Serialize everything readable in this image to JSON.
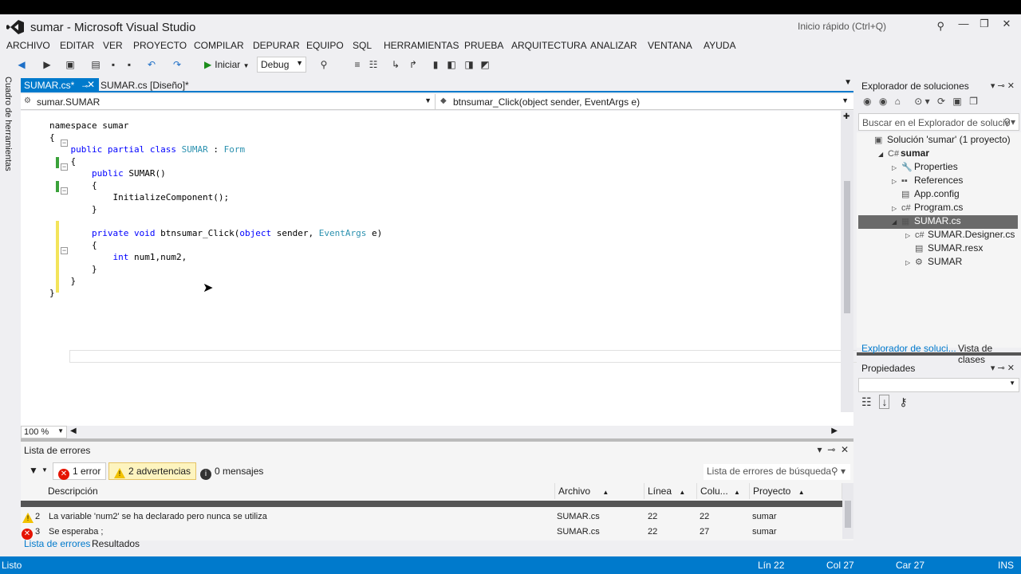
{
  "window": {
    "title": "sumar - Microsoft Visual Studio",
    "quick_launch": "Inicio rápido (Ctrl+Q)"
  },
  "menu": [
    "ARCHIVO",
    "EDITAR",
    "VER",
    "PROYECTO",
    "COMPILAR",
    "DEPURAR",
    "EQUIPO",
    "SQL",
    "HERRAMIENTAS",
    "PRUEBA",
    "ARQUITECTURA",
    "ANALIZAR",
    "VENTANA",
    "AYUDA"
  ],
  "toolbar": {
    "start_label": "Iniciar",
    "config": "Debug"
  },
  "side_tab": "Cuadro de herramientas",
  "tabs": {
    "active": "SUMAR.cs*",
    "other": "SUMAR.cs [Diseño]*"
  },
  "nav": {
    "left": "sumar.SUMAR",
    "right": "btnsumar_Click(object sender, EventArgs e)"
  },
  "code": [
    {
      "plain": "namespace sumar"
    },
    {
      "plain": "{"
    },
    {
      "parts": [
        [
          "kw",
          "    public partial class "
        ],
        [
          "ty",
          "SUMAR"
        ],
        [
          "",
          " : "
        ],
        [
          "ty",
          "Form"
        ]
      ]
    },
    {
      "plain": "    {"
    },
    {
      "parts": [
        [
          "kw",
          "        public "
        ],
        [
          "",
          "SUMAR()"
        ]
      ]
    },
    {
      "plain": "        {"
    },
    {
      "plain": "            InitializeComponent();"
    },
    {
      "plain": "        }"
    },
    {
      "plain": ""
    },
    {
      "parts": [
        [
          "kw",
          "        private void "
        ],
        [
          "",
          "btnsumar_Click("
        ],
        [
          "kw",
          "object"
        ],
        [
          "",
          " sender, "
        ],
        [
          "ty",
          "EventArgs"
        ],
        [
          "",
          " e)"
        ]
      ]
    },
    {
      "plain": "        {"
    },
    {
      "parts": [
        [
          "kw",
          "            int "
        ],
        [
          "",
          "num1,num2,"
        ]
      ]
    },
    {
      "plain": "        }"
    },
    {
      "plain": "    }"
    },
    {
      "plain": "}"
    }
  ],
  "zoom": "100 %",
  "error_list": {
    "title": "Lista de errores",
    "errors_btn": "1 error",
    "warnings_btn": "2 advertencias",
    "messages_btn": "0 mensajes",
    "search_placeholder": "Lista de errores de búsqueda",
    "columns": [
      "Descripción",
      "Archivo",
      "Línea",
      "Colu...",
      "Proyecto"
    ],
    "rows": [
      {
        "num": "2",
        "type": "warning",
        "desc": "La variable 'num2' se ha declarado pero nunca se utiliza",
        "file": "SUMAR.cs",
        "line": "22",
        "col": "22",
        "project": "sumar"
      },
      {
        "num": "3",
        "type": "error",
        "desc": "Se esperaba ;",
        "file": "SUMAR.cs",
        "line": "22",
        "col": "27",
        "project": "sumar"
      }
    ],
    "bottom_tabs": [
      "Lista de errores",
      "Resultados"
    ]
  },
  "solution_explorer": {
    "title": "Explorador de soluciones",
    "search": "Buscar en el Explorador de solucio",
    "tree": [
      {
        "label": "Solución 'sumar'  (1 proyecto)",
        "level": 0,
        "icon": "solution-icon",
        "twisty": ""
      },
      {
        "label": "sumar",
        "level": 1,
        "icon": "csharp-project-icon",
        "twisty": "◢",
        "bold": true
      },
      {
        "label": "Properties",
        "level": 2,
        "icon": "wrench-icon",
        "twisty": "▷"
      },
      {
        "label": "References",
        "level": 2,
        "icon": "references-icon",
        "twisty": "▷"
      },
      {
        "label": "App.config",
        "level": 2,
        "icon": "config-file-icon",
        "twisty": ""
      },
      {
        "label": "Program.cs",
        "level": 2,
        "icon": "csharp-file-icon",
        "twisty": "▷"
      },
      {
        "label": "SUMAR.cs",
        "level": 2,
        "icon": "form-icon",
        "twisty": "◢",
        "selected": true
      },
      {
        "label": "SUMAR.Designer.cs",
        "level": 3,
        "icon": "csharp-file-icon",
        "twisty": "▷"
      },
      {
        "label": "SUMAR.resx",
        "level": 3,
        "icon": "resx-file-icon",
        "twisty": ""
      },
      {
        "label": "SUMAR",
        "level": 3,
        "icon": "class-icon",
        "twisty": "▷"
      }
    ],
    "bottom_tabs": [
      "Explorador de soluci...",
      "Vista de clases"
    ]
  },
  "properties": {
    "title": "Propiedades"
  },
  "status": {
    "left": "Listo",
    "line": "Lín 22",
    "col": "Col 27",
    "char": "Car 27",
    "mode": "INS"
  },
  "colors": {
    "accent": "#007acc",
    "keyword": "#0000ff",
    "type": "#2b91af",
    "error": "#e51400",
    "warning": "#f2c200"
  }
}
